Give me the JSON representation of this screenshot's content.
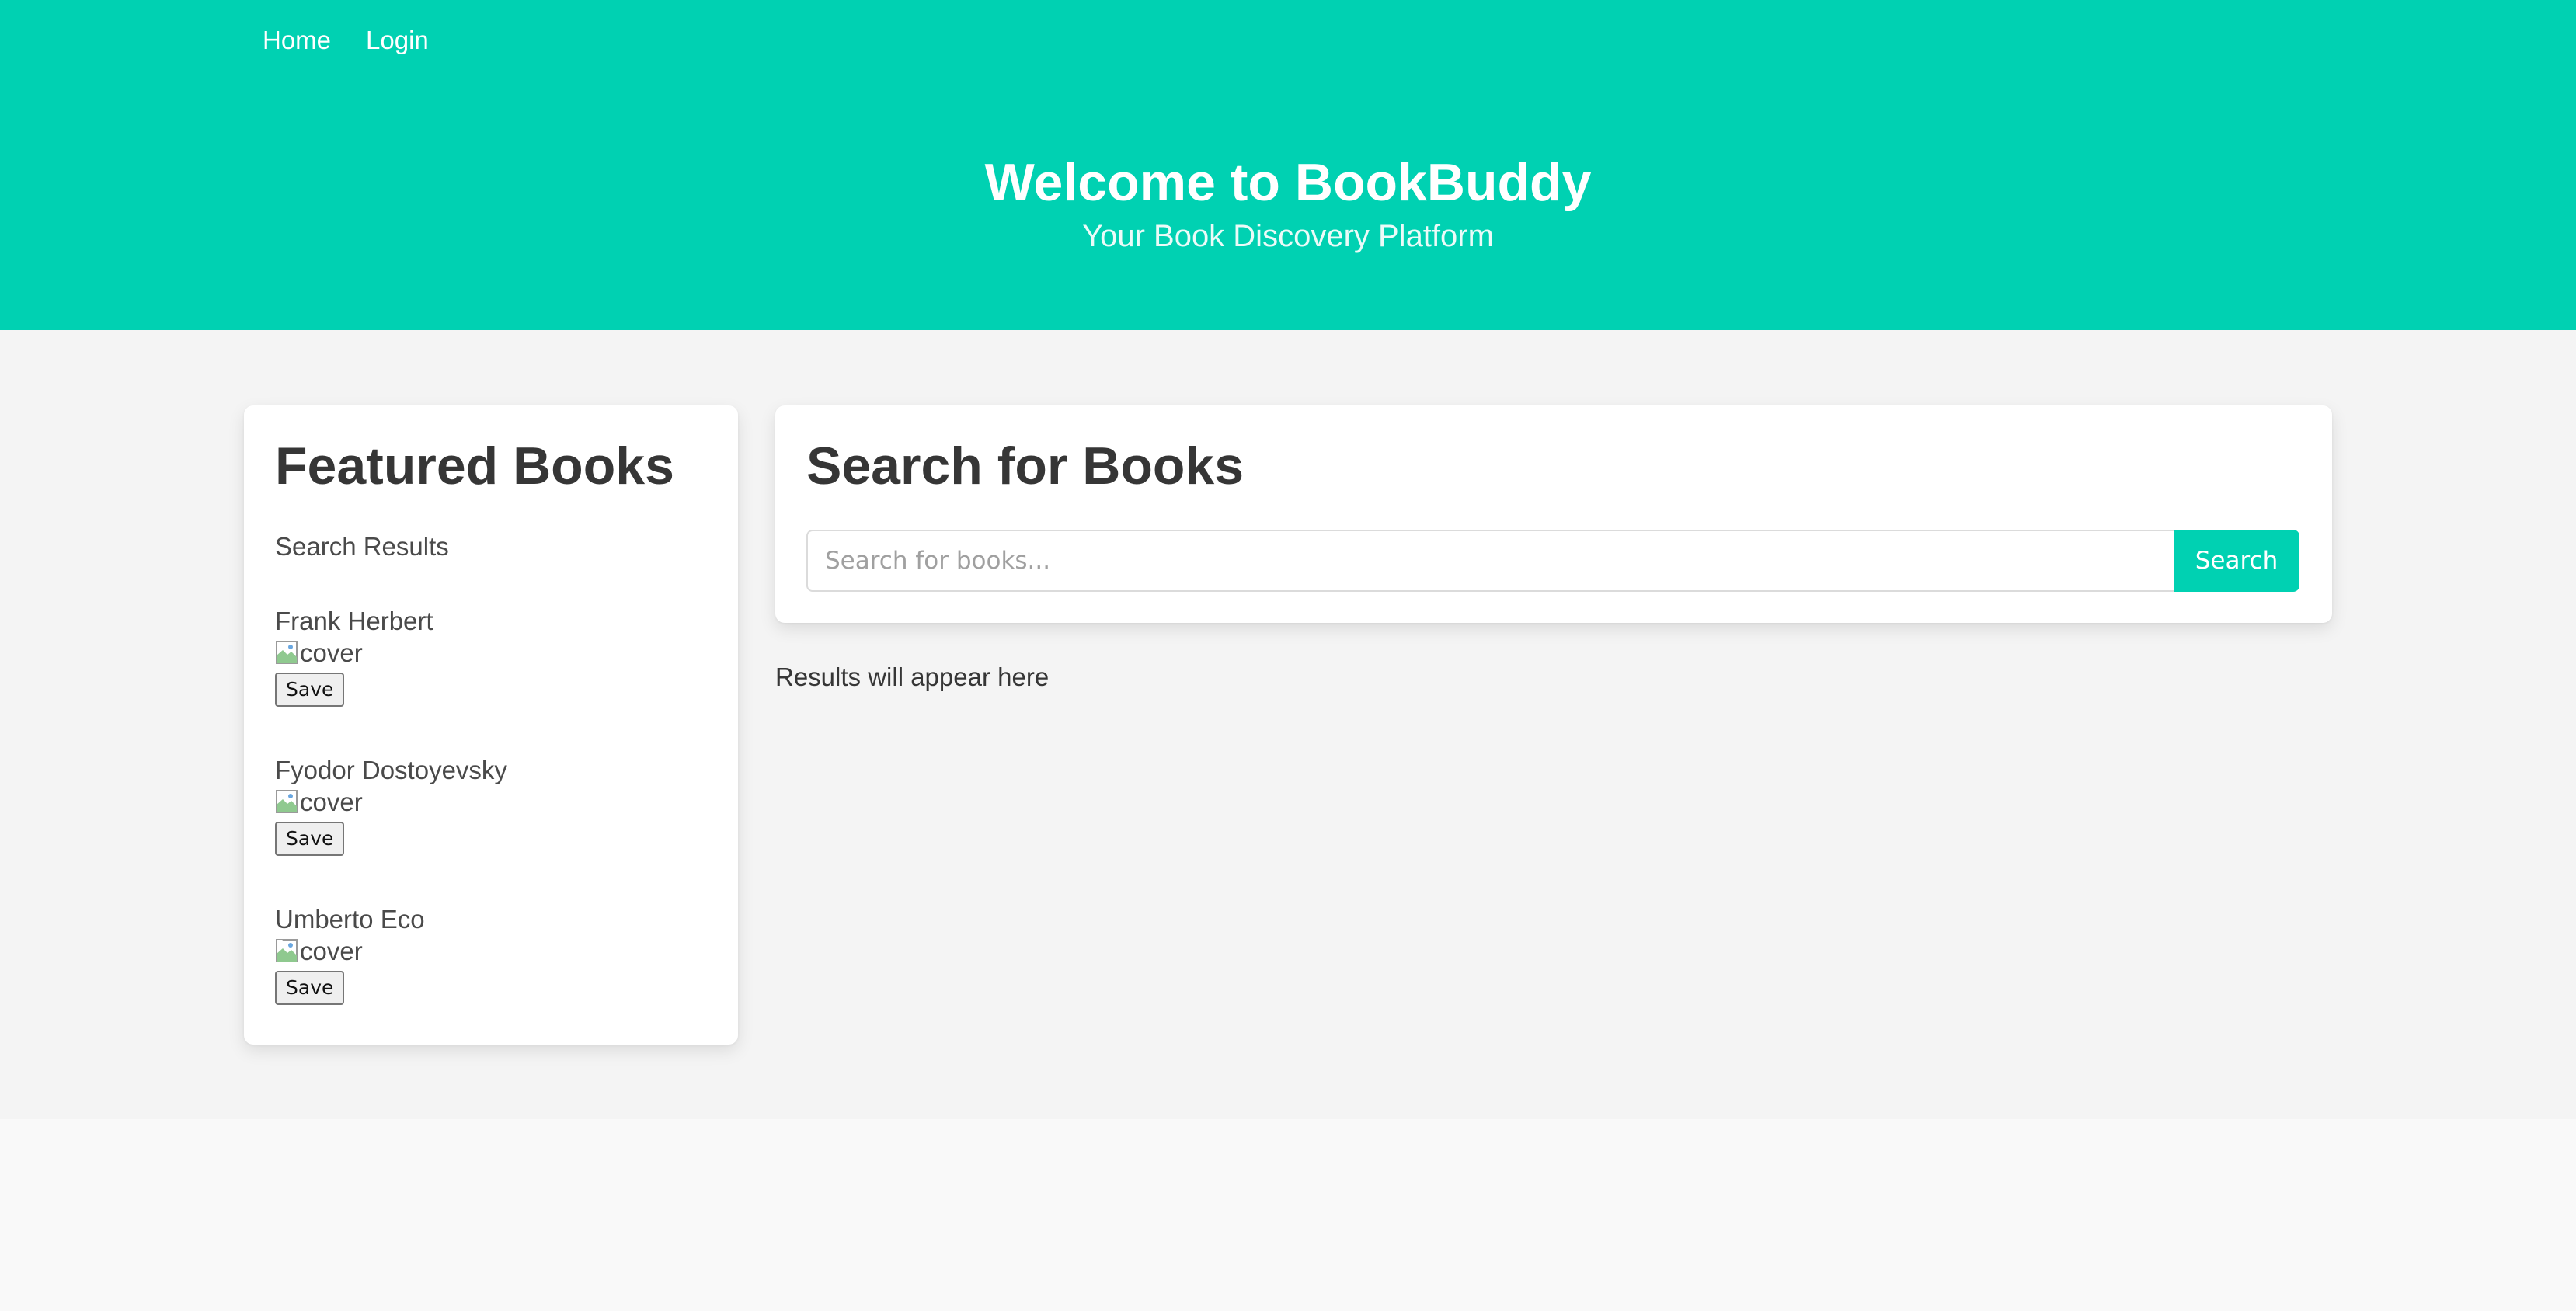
{
  "nav": {
    "items": [
      {
        "label": "Home"
      },
      {
        "label": "Login"
      }
    ]
  },
  "hero": {
    "title": "Welcome to BookBuddy",
    "subtitle": "Your Book Discovery Platform"
  },
  "featured": {
    "title": "Featured Books",
    "results_heading": "Search Results",
    "books": [
      {
        "author": "Frank Herbert",
        "cover_alt": "cover",
        "save_label": "Save"
      },
      {
        "author": "Fyodor Dostoyevsky",
        "cover_alt": "cover",
        "save_label": "Save"
      },
      {
        "author": "Umberto Eco",
        "cover_alt": "cover",
        "save_label": "Save"
      }
    ]
  },
  "search": {
    "title": "Search for Books",
    "placeholder": "Search for books...",
    "button_label": "Search",
    "results_placeholder": "Results will appear here"
  },
  "colors": {
    "accent": "#00d1b2",
    "section_bg": "#f4f4f4",
    "page_bg": "#f9f9f9"
  },
  "icons": {
    "broken_image": "broken-image-icon"
  }
}
